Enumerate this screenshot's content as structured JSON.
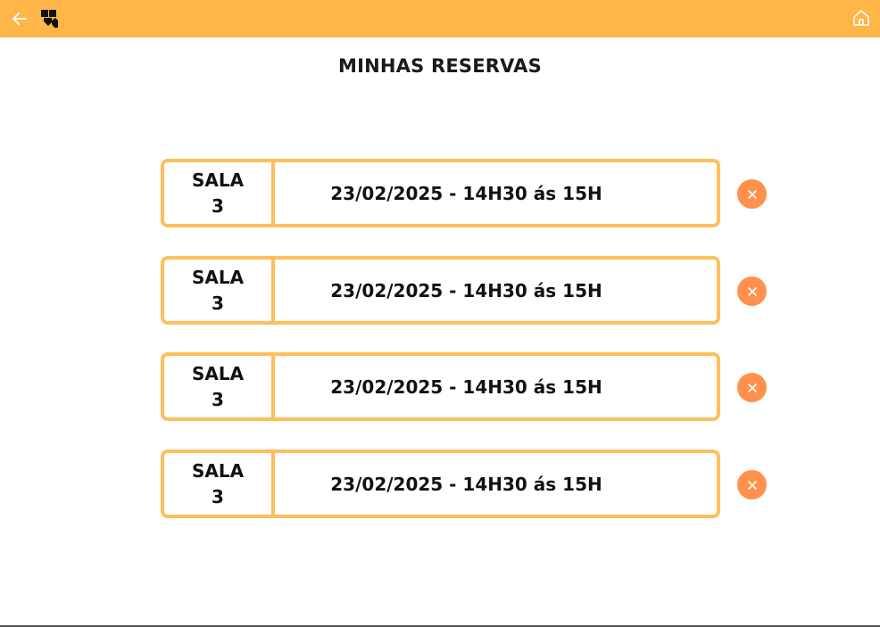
{
  "header": {
    "back_icon": "arrow-left-icon",
    "logo_icon": "app-logo-icon",
    "home_icon": "home-icon",
    "bar_color": "#FFB648"
  },
  "page": {
    "title": "MINHAS RESERVAS"
  },
  "reservations": [
    {
      "room_label": "SALA",
      "room_number": "3",
      "datetime": "23/02/2025 - 14H30 ás 15H"
    },
    {
      "room_label": "SALA",
      "room_number": "3",
      "datetime": "23/02/2025 - 14H30 ás 15H"
    },
    {
      "room_label": "SALA",
      "room_number": "3",
      "datetime": "23/02/2025 - 14H30 ás 15H"
    },
    {
      "room_label": "SALA",
      "room_number": "3",
      "datetime": "23/02/2025 - 14H30 ás 15H"
    }
  ],
  "colors": {
    "card_border": "#FFBF5C",
    "cancel_button": "#FF914D"
  }
}
